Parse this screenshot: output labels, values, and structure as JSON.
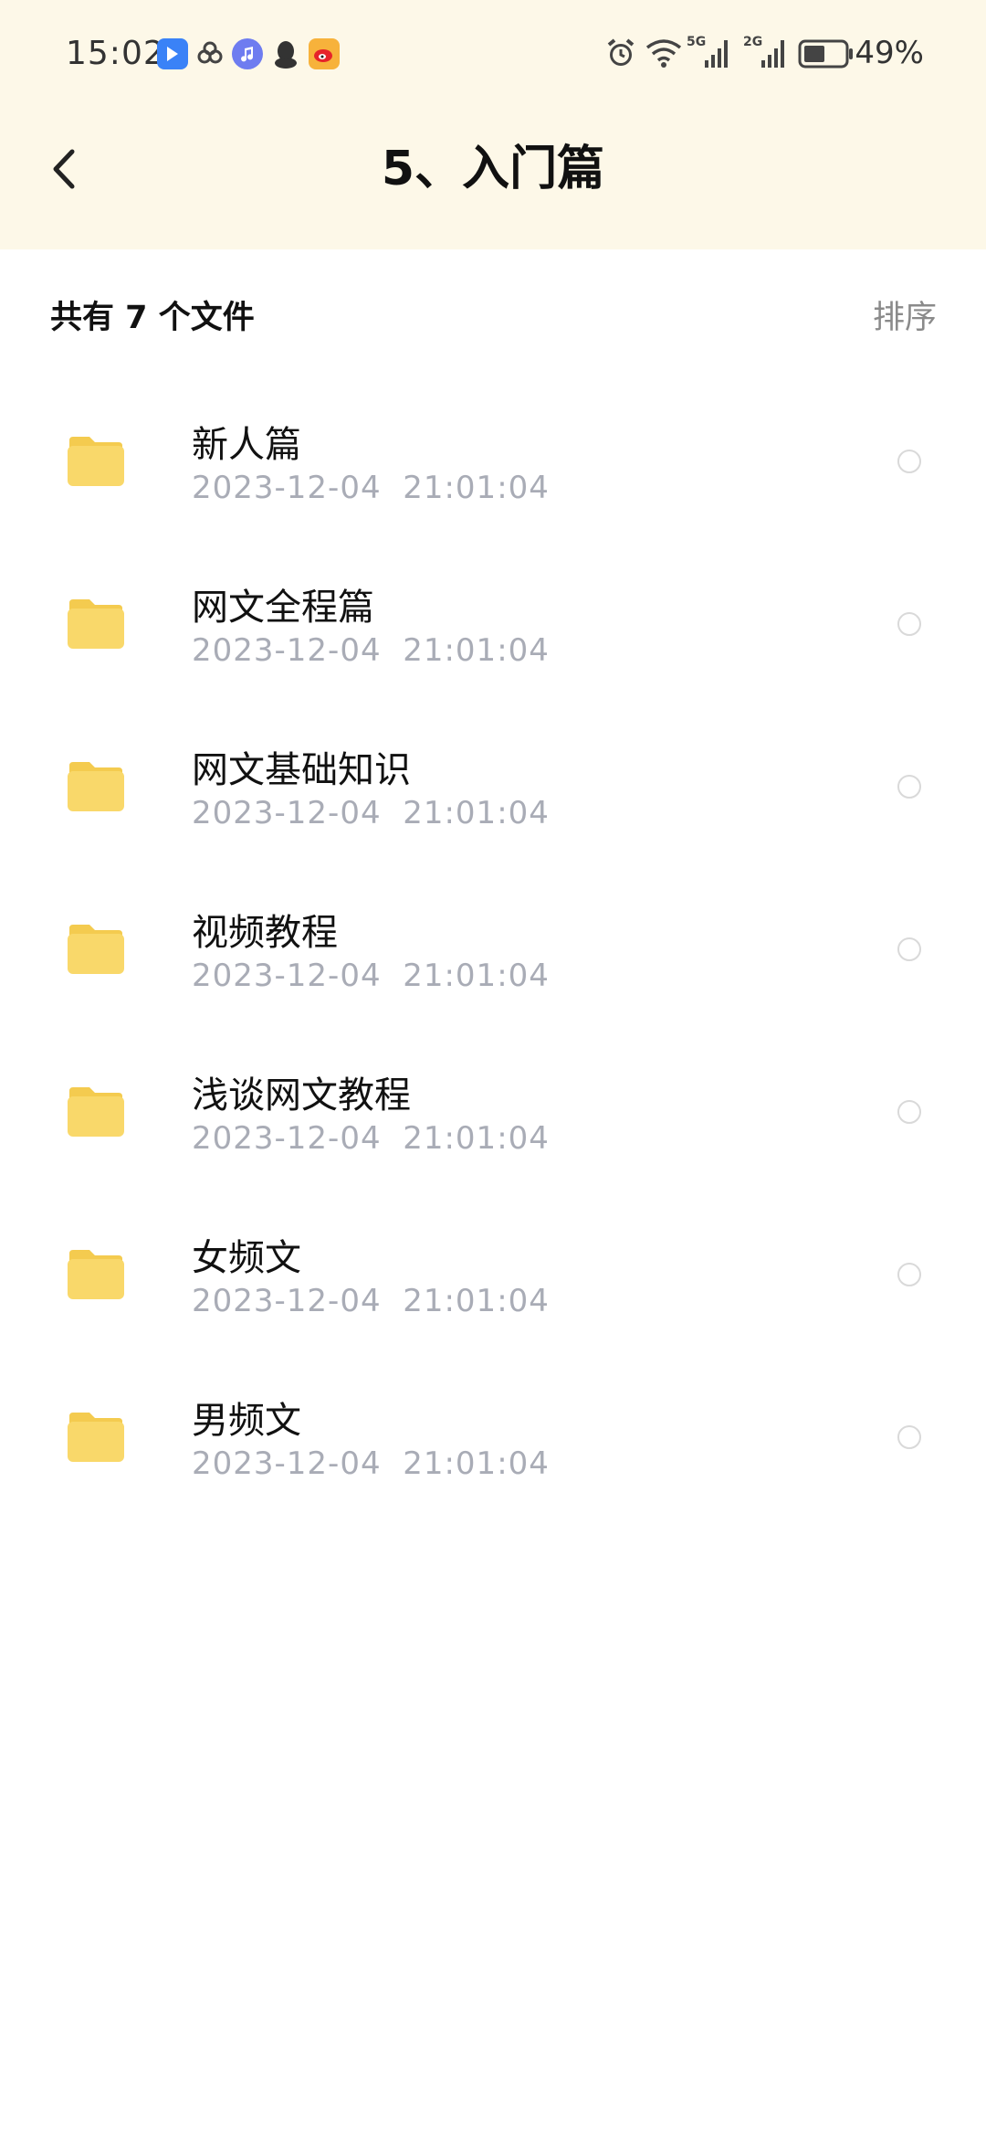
{
  "status_bar": {
    "time": "15:02",
    "battery_percent": "49%",
    "network_5g_label": "5G",
    "network_2g_label": "2G",
    "app_icons": [
      "arrow-app-icon",
      "link-app-icon",
      "music-app-icon",
      "qq-penguin-icon",
      "weibo-icon"
    ],
    "system_icons": [
      "alarm-icon",
      "wifi-icon",
      "signal-5g-icon",
      "signal-2g-icon",
      "battery-icon"
    ]
  },
  "header": {
    "title": "5、入门篇",
    "back_icon": "chevron-left-icon"
  },
  "summary": {
    "count_text": "共有 7 个文件",
    "sort_label": "排序"
  },
  "files": [
    {
      "name": "新人篇",
      "date": "2023-12-04  21:01:04"
    },
    {
      "name": "网文全程篇",
      "date": "2023-12-04  21:01:04"
    },
    {
      "name": "网文基础知识",
      "date": "2023-12-04  21:01:04"
    },
    {
      "name": "视频教程",
      "date": "2023-12-04  21:01:04"
    },
    {
      "name": "浅谈网文教程",
      "date": "2023-12-04  21:01:04"
    },
    {
      "name": "女频文",
      "date": "2023-12-04  21:01:04"
    },
    {
      "name": "男频文",
      "date": "2023-12-04  21:01:04"
    }
  ],
  "colors": {
    "header_background": "#fdf8e8",
    "folder_yellow": "#f9d86a",
    "folder_tab": "#f4cb4f",
    "date_gray": "#a9acb6",
    "sort_gray": "#8a8a8a",
    "radio_border": "#d9d9d9"
  }
}
